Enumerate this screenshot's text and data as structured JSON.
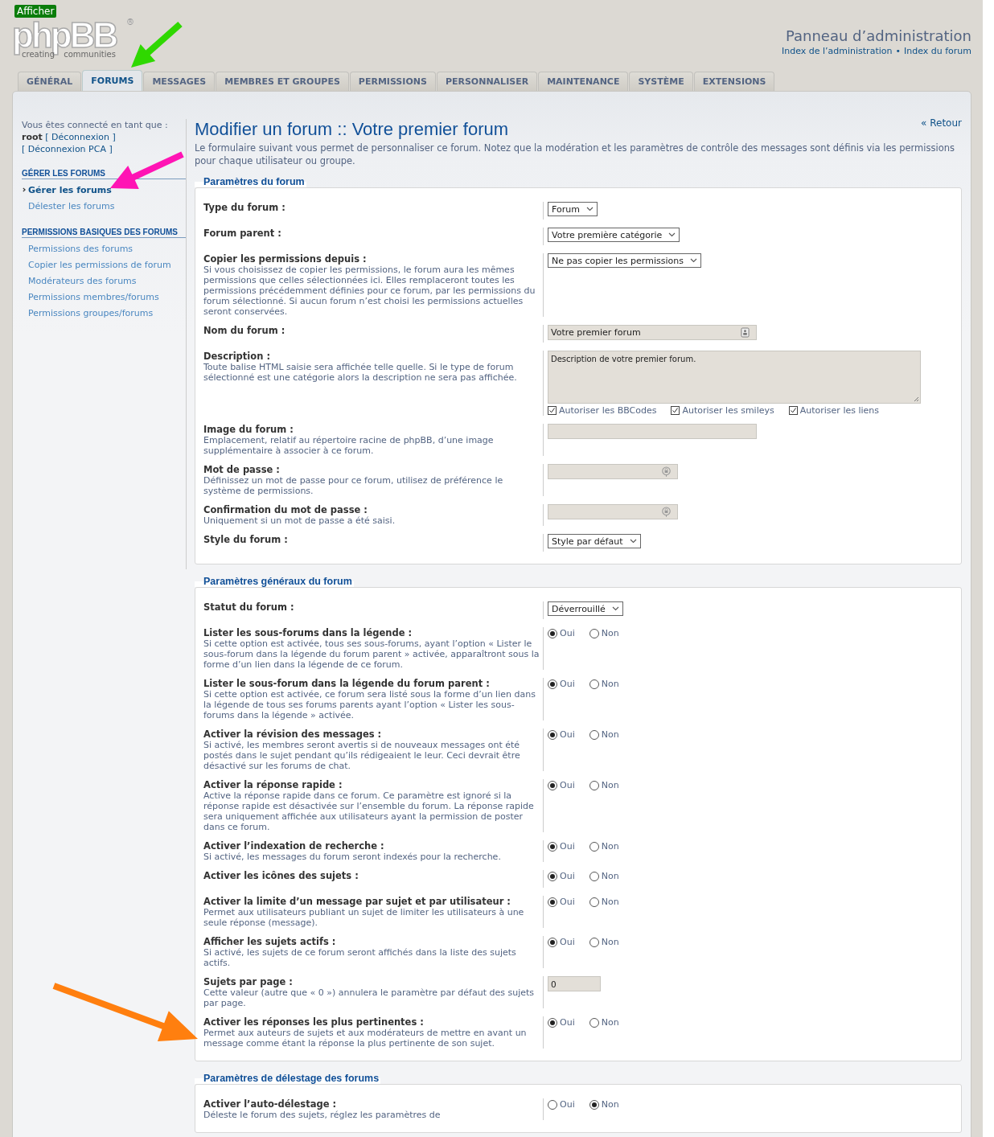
{
  "badge": "Afficher",
  "logo": {
    "name": "phpBB",
    "mark": "®",
    "tagline": "creating communities"
  },
  "header": {
    "title": "Panneau d’administration",
    "links": [
      "Index de l’administration",
      "Index du forum"
    ],
    "separator": "•"
  },
  "tabs": [
    {
      "label": "GÉNÉRAL",
      "selected": false
    },
    {
      "label": "FORUMS",
      "selected": true
    },
    {
      "label": "MESSAGES",
      "selected": false
    },
    {
      "label": "MEMBRES ET GROUPES",
      "selected": false
    },
    {
      "label": "PERMISSIONS",
      "selected": false
    },
    {
      "label": "PERSONNALISER",
      "selected": false
    },
    {
      "label": "MAINTENANCE",
      "selected": false
    },
    {
      "label": "SYSTÈME",
      "selected": false
    },
    {
      "label": "EXTENSIONS",
      "selected": false
    }
  ],
  "sidebar": {
    "intro": "Vous êtes connecté en tant que :",
    "user": "root",
    "logout": "[ Déconnexion ]",
    "logout_pca": "[ Déconnexion PCA ]",
    "sections": [
      {
        "title": "GÉRER LES FORUMS",
        "items": [
          {
            "label": "Gérer les forums",
            "selected": true
          },
          {
            "label": "Délester les forums",
            "selected": false
          }
        ]
      },
      {
        "title": "PERMISSIONS BASIQUES DES FORUMS",
        "items": [
          {
            "label": "Permissions des forums",
            "selected": false
          },
          {
            "label": "Copier les permissions de forum",
            "selected": false
          },
          {
            "label": "Modérateurs des forums",
            "selected": false
          },
          {
            "label": "Permissions membres/forums",
            "selected": false
          },
          {
            "label": "Permissions groupes/forums",
            "selected": false
          }
        ]
      }
    ]
  },
  "page": {
    "title": "Modifier un forum :: Votre premier forum",
    "back": "« Retour",
    "intro": "Le formulaire suivant vous permet de personnaliser ce forum. Notez que la modération et les paramètres de contrôle des messages sont définis via les permissions pour chaque utilisateur ou groupe."
  },
  "fieldsets": [
    {
      "legend": "Paramètres du forum",
      "rows": [
        {
          "label": "Type du forum :",
          "kind": "select",
          "value": "Forum"
        },
        {
          "label": "Forum parent :",
          "kind": "select",
          "value": "Votre première catégorie"
        },
        {
          "label": "Copier les permissions depuis :",
          "description": "Si vous choisissez de copier les permissions, le forum aura les mêmes permissions que celles sélectionnées ici. Elles remplaceront toutes les permissions précédemment définies pour ce forum, par les permissions du forum sélectionné. Si aucun forum n’est choisi les permissions actuelles seront conservées.",
          "kind": "select",
          "value": "Ne pas copier les permissions"
        },
        {
          "label": "Nom du forum :",
          "kind": "autofill",
          "value": "Votre premier forum"
        },
        {
          "label": "Description :",
          "description": "Toute balise HTML saisie sera affichée telle quelle. Si le type de forum sélectionné est une catégorie alors la description ne sera pas affichée.",
          "kind": "textarea",
          "value": "Description de votre premier forum.",
          "checkboxes": [
            {
              "label": "Autoriser les BBCodes",
              "checked": true
            },
            {
              "label": "Autoriser les smileys",
              "checked": true
            },
            {
              "label": "Autoriser les liens",
              "checked": true
            }
          ]
        },
        {
          "label": "Image du forum :",
          "description": "Emplacement, relatif au répertoire racine de phpBB, d’une image supplémentaire à associer à ce forum.",
          "kind": "text"
        },
        {
          "label": "Mot de passe :",
          "description": "Définissez un mot de passe pour ce forum, utilisez de préférence le système de permissions.",
          "kind": "password"
        },
        {
          "label": "Confirmation du mot de passe :",
          "description": "Uniquement si un mot de passe a été saisi.",
          "kind": "password"
        },
        {
          "label": "Style du forum :",
          "kind": "select",
          "value": "Style par défaut"
        }
      ]
    },
    {
      "legend": "Paramètres généraux du forum",
      "rows": [
        {
          "label": "Statut du forum :",
          "kind": "select",
          "value": "Déverrouillé"
        },
        {
          "label": "Lister les sous-forums dans la légende :",
          "description": "Si cette option est activée, tous ses sous-forums, ayant l’option « Lister le sous-forum dans la légende du forum parent » activée, apparaîtront sous la forme d’un lien dans la légende de ce forum.",
          "kind": "radio",
          "options": [
            {
              "label": "Oui",
              "selected": true
            },
            {
              "label": "Non",
              "selected": false
            }
          ]
        },
        {
          "label": "Lister le sous-forum dans la légende du forum parent :",
          "description": "Si cette option est activée, ce forum sera listé sous la forme d’un lien dans la légende de tous ses forums parents ayant l’option « Lister les sous-forums dans la légende » activée.",
          "kind": "radio",
          "options": [
            {
              "label": "Oui",
              "selected": true
            },
            {
              "label": "Non",
              "selected": false
            }
          ]
        },
        {
          "label": "Activer la révision des messages :",
          "description": "Si activé, les membres seront avertis si de nouveaux messages ont été postés dans le sujet pendant qu’ils rédigeaient le leur. Ceci devrait être désactivé sur les forums de chat.",
          "kind": "radio",
          "options": [
            {
              "label": "Oui",
              "selected": true
            },
            {
              "label": "Non",
              "selected": false
            }
          ]
        },
        {
          "label": "Activer la réponse rapide :",
          "description": "Active la réponse rapide dans ce forum. Ce paramètre est ignoré si la réponse rapide est désactivée sur l’ensemble du forum. La réponse rapide sera uniquement affichée aux utilisateurs ayant la permission de poster dans ce forum.",
          "kind": "radio",
          "options": [
            {
              "label": "Oui",
              "selected": true
            },
            {
              "label": "Non",
              "selected": false
            }
          ]
        },
        {
          "label": "Activer l’indexation de recherche :",
          "description": "Si activé, les messages du forum seront indexés pour la recherche.",
          "kind": "radio",
          "options": [
            {
              "label": "Oui",
              "selected": true
            },
            {
              "label": "Non",
              "selected": false
            }
          ]
        },
        {
          "label": "Activer les icônes des sujets :",
          "kind": "radio",
          "options": [
            {
              "label": "Oui",
              "selected": true
            },
            {
              "label": "Non",
              "selected": false
            }
          ]
        },
        {
          "label": "Activer la limite d’un message par sujet et par utilisateur :",
          "description": "Permet aux utilisateurs publiant un sujet de limiter les utilisateurs à une seule réponse (message).",
          "kind": "radio",
          "options": [
            {
              "label": "Oui",
              "selected": true
            },
            {
              "label": "Non",
              "selected": false
            }
          ]
        },
        {
          "label": "Afficher les sujets actifs :",
          "description": "Si activé, les sujets de ce forum seront affichés dans la liste des sujets actifs.",
          "kind": "radio",
          "options": [
            {
              "label": "Oui",
              "selected": true
            },
            {
              "label": "Non",
              "selected": false
            }
          ]
        },
        {
          "label": "Sujets par page :",
          "description": "Cette valeur (autre que « 0 ») annulera le paramètre par défaut des sujets par page.",
          "kind": "number",
          "value": "0"
        },
        {
          "label": "Activer les réponses les plus pertinentes :",
          "description": "Permet aux auteurs de sujets et aux modérateurs de mettre en avant un message comme étant la réponse la plus pertinente de son sujet.",
          "kind": "radio",
          "options": [
            {
              "label": "Oui",
              "selected": true
            },
            {
              "label": "Non",
              "selected": false
            }
          ]
        }
      ]
    },
    {
      "legend": "Paramètres de délestage des forums",
      "rows": [
        {
          "label": "Activer l’auto-délestage :",
          "description": "Déleste le forum des sujets, réglez les paramètres de",
          "kind": "radio",
          "options": [
            {
              "label": "Oui",
              "selected": false
            },
            {
              "label": "Non",
              "selected": true
            }
          ]
        }
      ]
    }
  ],
  "annotations": [
    {
      "color": "#2fd800"
    },
    {
      "color": "#ff14b4"
    },
    {
      "color": "#ff7f0f"
    }
  ]
}
